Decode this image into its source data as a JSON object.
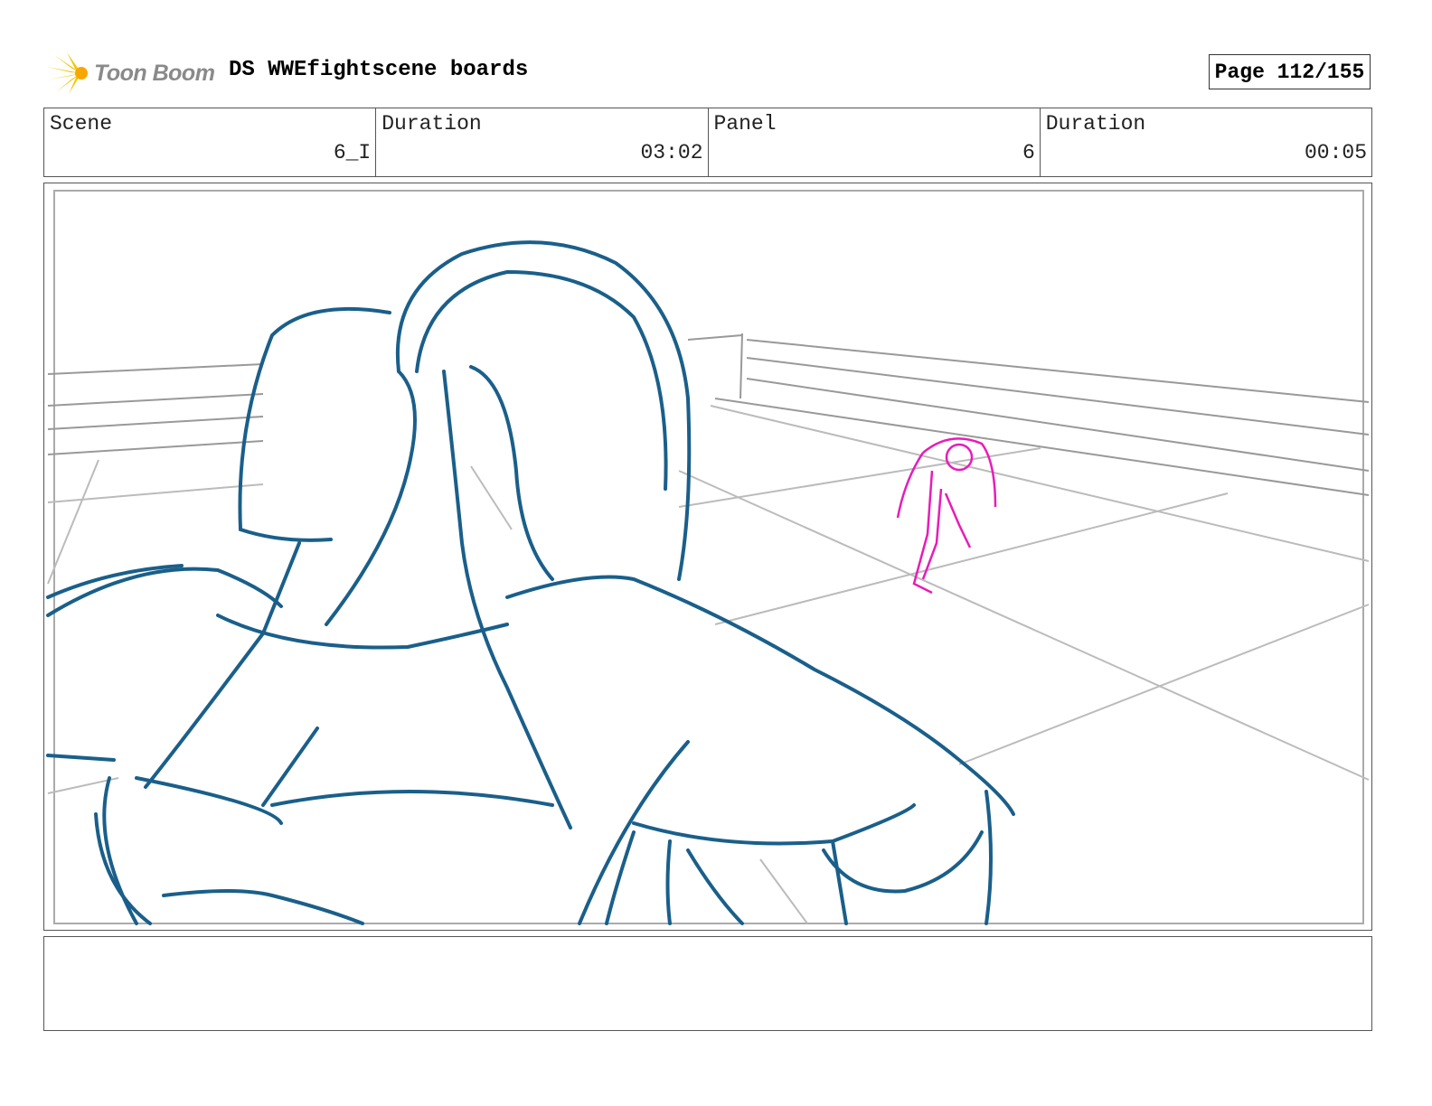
{
  "header": {
    "logo_text": "Toon Boom",
    "title": "DS WWEfightscene boards",
    "page": "Page 112/155"
  },
  "info": {
    "scene_label": "Scene",
    "scene_value": "6_I",
    "scene_duration_label": "Duration",
    "scene_duration_value": "03:02",
    "panel_label": "Panel",
    "panel_value": "6",
    "panel_duration_label": "Duration",
    "panel_duration_value": "00:05"
  },
  "colors": {
    "foreground_sketch": "#1a5f8a",
    "background_figure": "#e81cb8",
    "ring_lines": "#a0a0a0"
  },
  "notes": {}
}
